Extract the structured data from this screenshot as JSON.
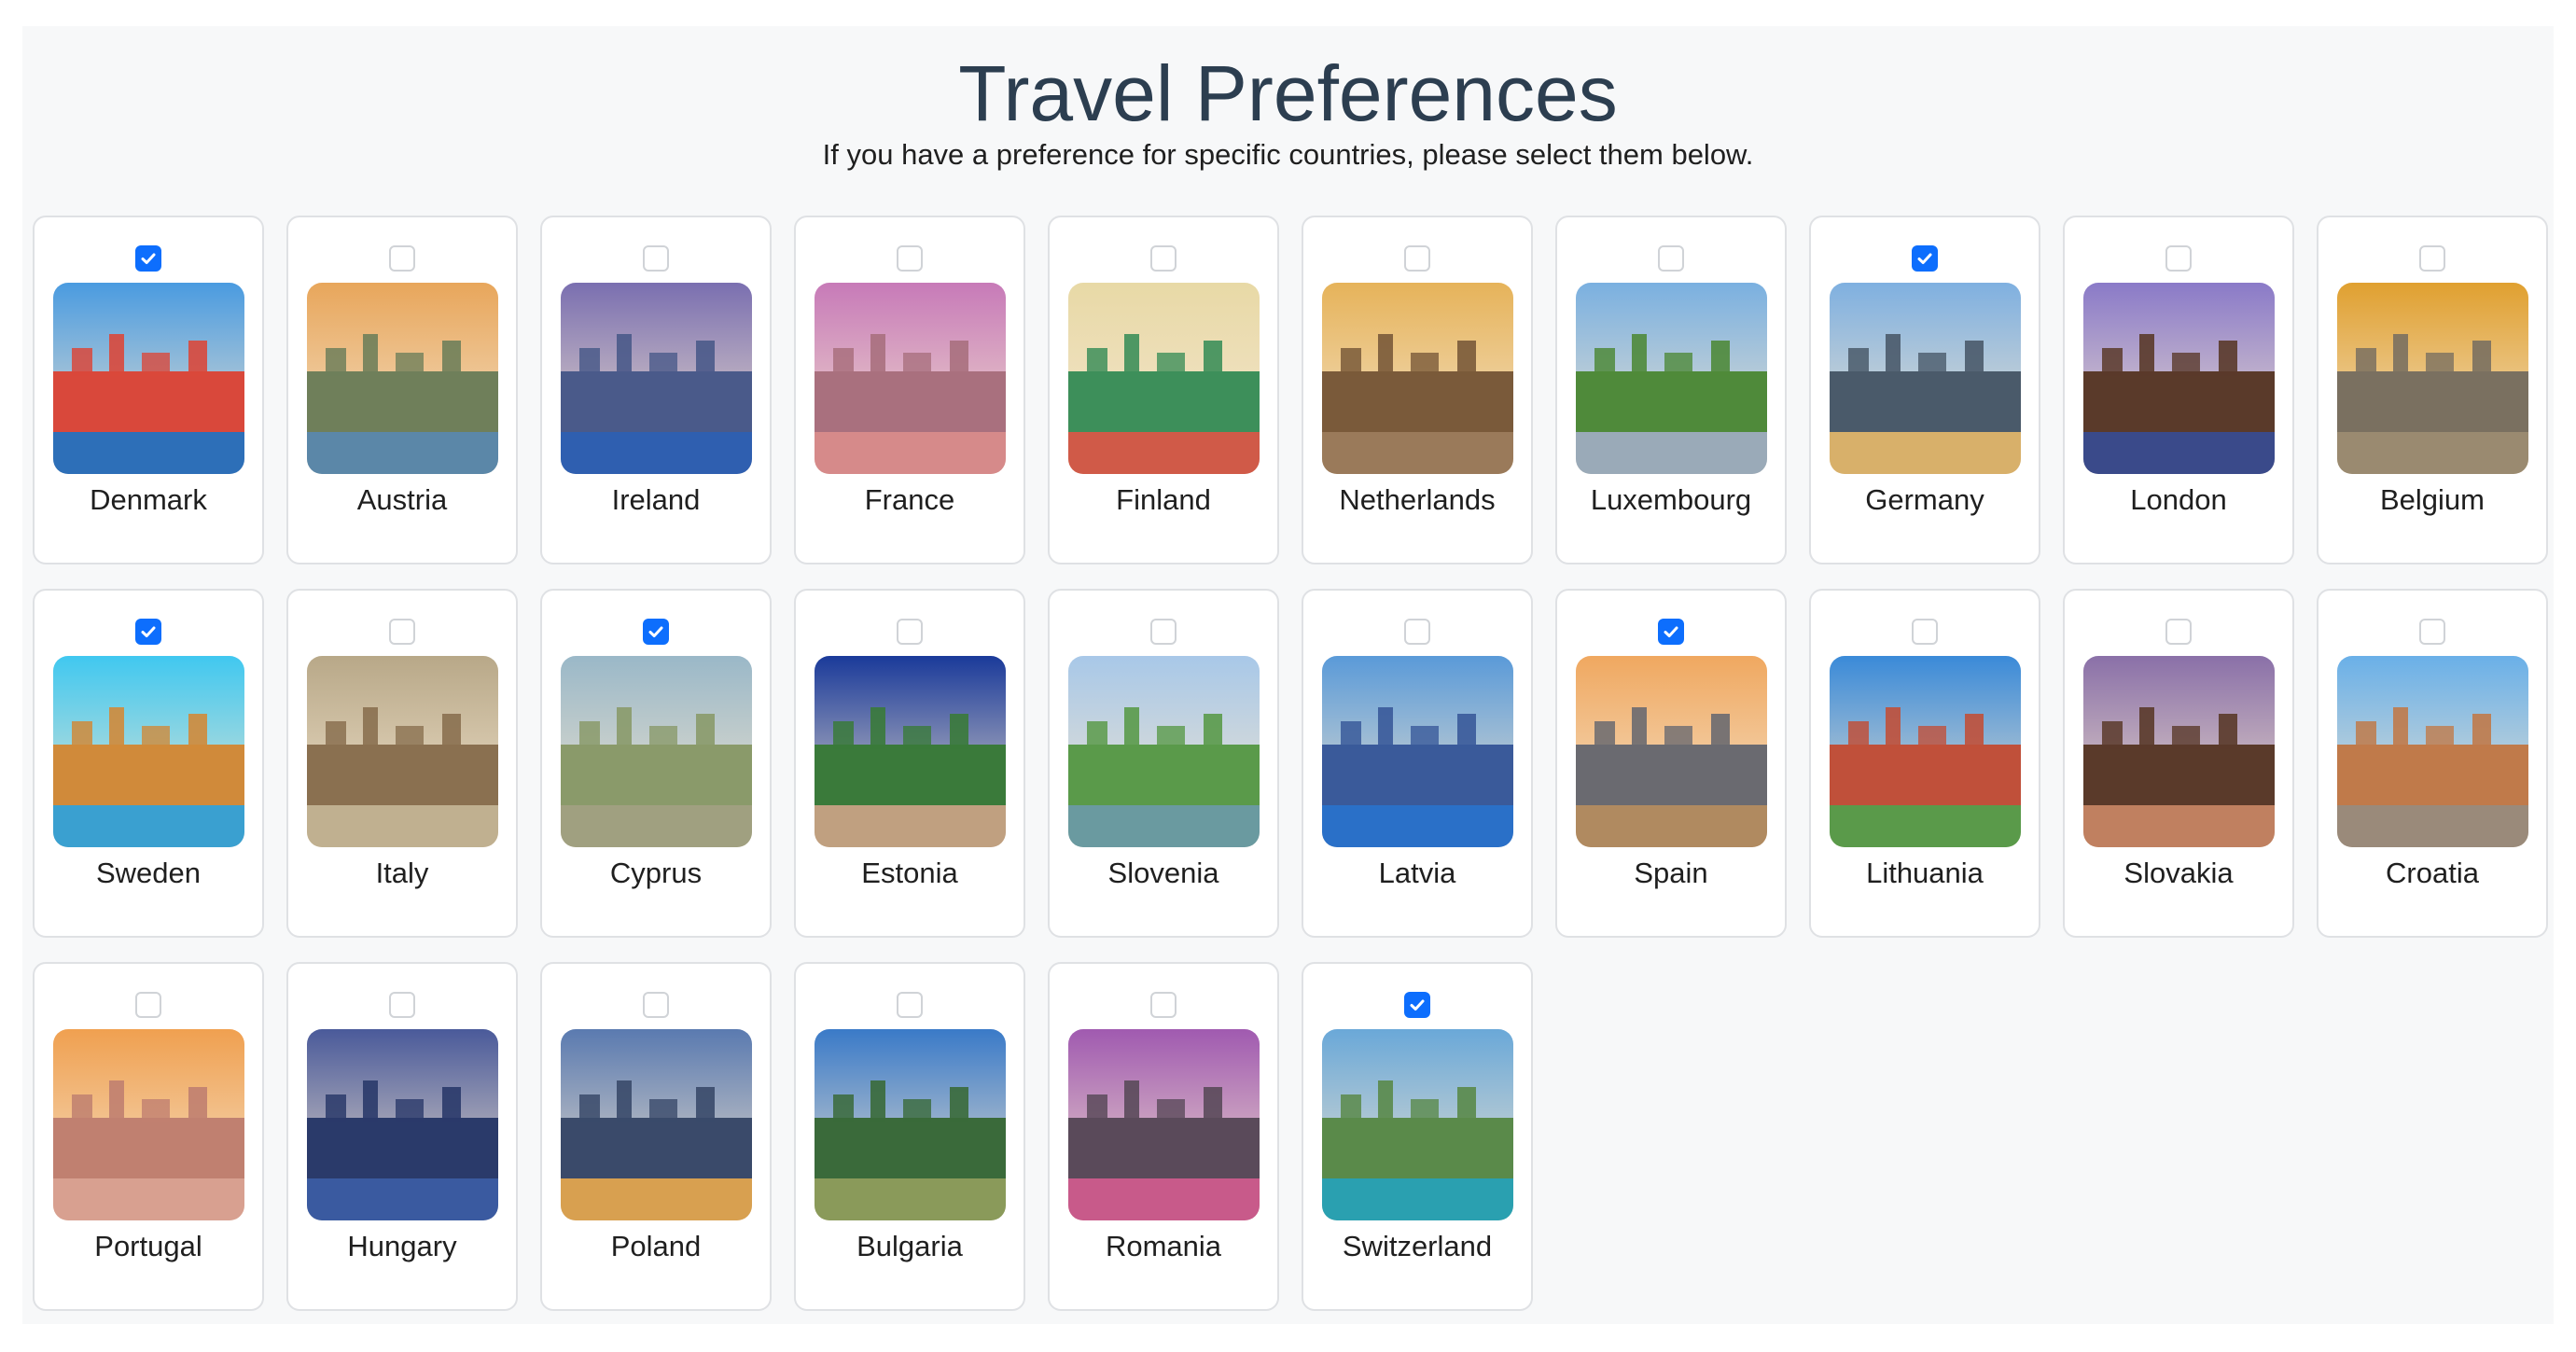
{
  "page": {
    "title": "Travel Preferences",
    "subtitle": "If you have a preference for specific countries, please select them below."
  },
  "colors": {
    "accent": "#0d6efd",
    "title": "#2c3e50",
    "panel_bg": "#f7f8f9",
    "card_border": "#dfe1e4"
  },
  "countries": [
    {
      "name": "Denmark",
      "checked": true,
      "sky": "#4a9be0",
      "ground": "#d9483b",
      "water": "#2d6fb8"
    },
    {
      "name": "Austria",
      "checked": false,
      "sky": "#e8a65b",
      "ground": "#6f7f5a",
      "water": "#5b87a8"
    },
    {
      "name": "Ireland",
      "checked": false,
      "sky": "#7a6fb0",
      "ground": "#4a5a8a",
      "water": "#2f5fb0"
    },
    {
      "name": "France",
      "checked": false,
      "sky": "#c77ab8",
      "ground": "#a9707e",
      "water": "#d68a8a"
    },
    {
      "name": "Finland",
      "checked": false,
      "sky": "#e8d9a6",
      "ground": "#3d8f5a",
      "water": "#d05a48"
    },
    {
      "name": "Netherlands",
      "checked": false,
      "sky": "#e6b35a",
      "ground": "#7a5a3a",
      "water": "#9a7a5a"
    },
    {
      "name": "Luxembourg",
      "checked": false,
      "sky": "#7ab0e0",
      "ground": "#4f8a3a",
      "water": "#9aaab8"
    },
    {
      "name": "Germany",
      "checked": true,
      "sky": "#7fb0e0",
      "ground": "#4a5a6a",
      "water": "#d8b06a"
    },
    {
      "name": "London",
      "checked": false,
      "sky": "#8a7ac8",
      "ground": "#5a3a2a",
      "water": "#3a4a8a"
    },
    {
      "name": "Belgium",
      "checked": false,
      "sky": "#e0a030",
      "ground": "#7a7060",
      "water": "#9a8a70"
    },
    {
      "name": "Sweden",
      "checked": true,
      "sky": "#40c8f0",
      "ground": "#d08a3a",
      "water": "#3aa0d0"
    },
    {
      "name": "Italy",
      "checked": false,
      "sky": "#b8a888",
      "ground": "#8a7050",
      "water": "#c0b090"
    },
    {
      "name": "Cyprus",
      "checked": true,
      "sky": "#9ab8c8",
      "ground": "#8a9a6a",
      "water": "#a0a080"
    },
    {
      "name": "Estonia",
      "checked": false,
      "sky": "#1a3a9a",
      "ground": "#3a7a3a",
      "water": "#c0a080"
    },
    {
      "name": "Slovenia",
      "checked": false,
      "sky": "#a8c8e8",
      "ground": "#5a9a4a",
      "water": "#6a9aa0"
    },
    {
      "name": "Latvia",
      "checked": false,
      "sky": "#5a9ad8",
      "ground": "#3a5a9a",
      "water": "#2a70c8"
    },
    {
      "name": "Spain",
      "checked": true,
      "sky": "#f0a860",
      "ground": "#6a6a70",
      "water": "#b08a60"
    },
    {
      "name": "Lithuania",
      "checked": false,
      "sky": "#3a8ad8",
      "ground": "#c0503a",
      "water": "#5a9a4a"
    },
    {
      "name": "Slovakia",
      "checked": false,
      "sky": "#8a70a8",
      "ground": "#5a3a2a",
      "water": "#c08060"
    },
    {
      "name": "Croatia",
      "checked": false,
      "sky": "#6ab0e8",
      "ground": "#c07a4a",
      "water": "#9a8a7a"
    },
    {
      "name": "Portugal",
      "checked": false,
      "sky": "#f0a050",
      "ground": "#c08070",
      "water": "#d8a090"
    },
    {
      "name": "Hungary",
      "checked": false,
      "sky": "#4a5a9a",
      "ground": "#2a3a6a",
      "water": "#3a5aa0"
    },
    {
      "name": "Poland",
      "checked": false,
      "sky": "#5a7ab0",
      "ground": "#3a4a6a",
      "water": "#d8a050"
    },
    {
      "name": "Bulgaria",
      "checked": false,
      "sky": "#3a7ac8",
      "ground": "#3a6a3a",
      "water": "#8a9a5a"
    },
    {
      "name": "Romania",
      "checked": false,
      "sky": "#a05ab0",
      "ground": "#5a4a5a",
      "water": "#c85a8a"
    },
    {
      "name": "Switzerland",
      "checked": true,
      "sky": "#6aa8d8",
      "ground": "#5a8a4a",
      "water": "#2aa0b0"
    }
  ]
}
